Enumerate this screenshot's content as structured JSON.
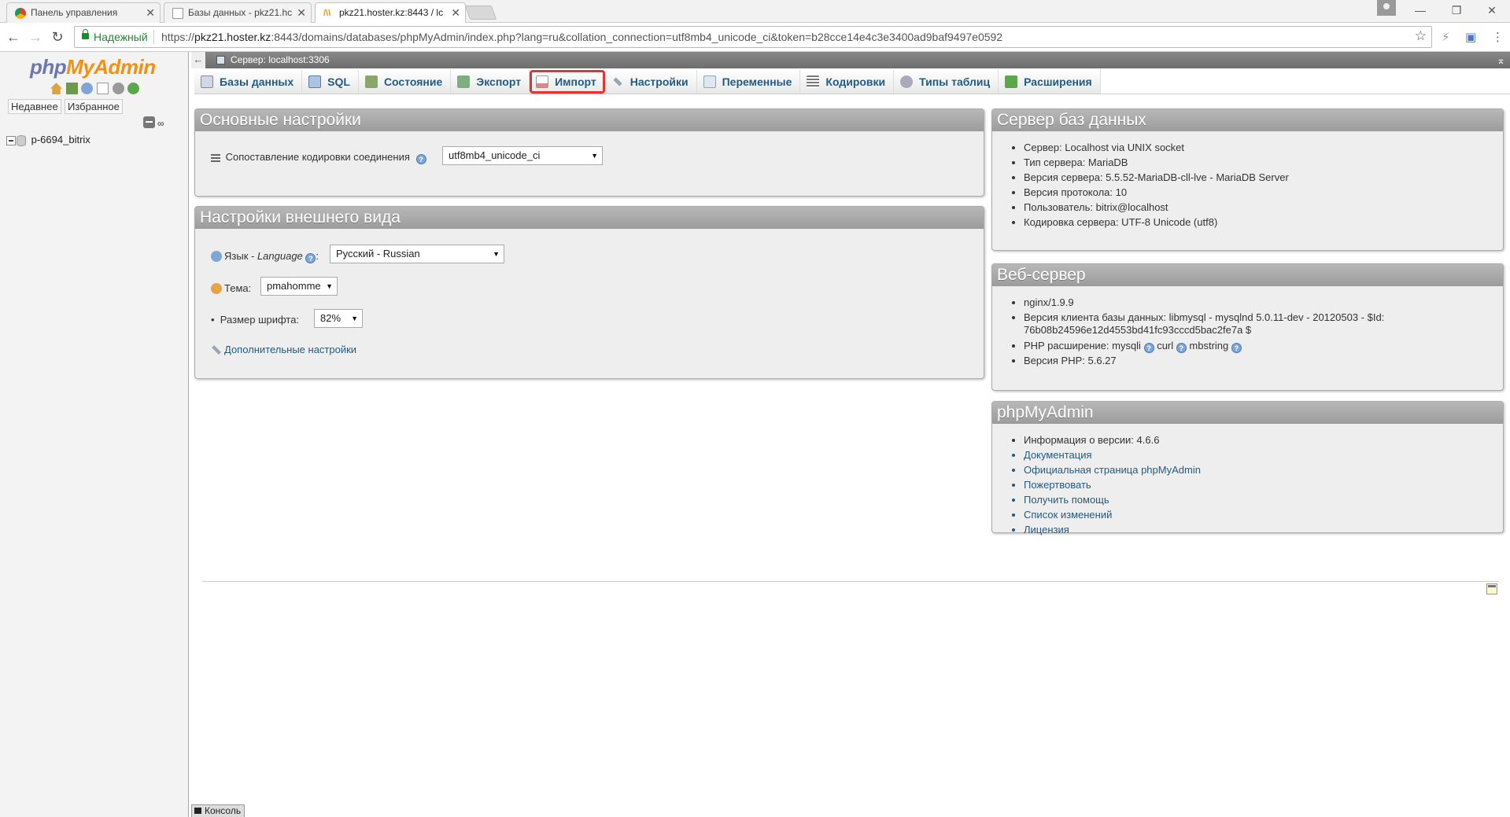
{
  "browser": {
    "tabs": [
      {
        "title": "Панель управления",
        "active": false
      },
      {
        "title": "Базы данных - pkz21.hc",
        "active": false
      },
      {
        "title": "pkz21.hoster.kz:8443 / lc",
        "active": true
      }
    ],
    "secure_label": "Надежный",
    "url_prefix": "https://",
    "url_host": "pkz21.hoster.kz",
    "url_rest": ":8443/domains/databases/phpMyAdmin/index.php?lang=ru&collation_connection=utf8mb4_unicode_ci&token=b28cce14e4c3e3400ad9baf9497e0592"
  },
  "left": {
    "logo_php": "php",
    "logo_myadmin": "MyAdmin",
    "recent": "Недавнее",
    "favorites": "Избранное",
    "database": "p-6694_bitrix"
  },
  "serverbar": {
    "label": "Сервер: localhost:3306"
  },
  "menu": [
    {
      "label": "Базы данных",
      "icon": "databases-icon",
      "color": "#cfd8e6"
    },
    {
      "label": "SQL",
      "icon": "sql-icon",
      "color": "#aac4e6"
    },
    {
      "label": "Состояние",
      "icon": "status-icon",
      "color": "#8aa66a"
    },
    {
      "label": "Экспорт",
      "icon": "export-icon",
      "color": "#7fae7f"
    },
    {
      "label": "Импорт",
      "icon": "import-icon",
      "color": "#d88"
    },
    {
      "label": "Настройки",
      "icon": "settings-icon",
      "color": "#9aa4b4"
    },
    {
      "label": "Переменные",
      "icon": "variables-icon",
      "color": "#b0c4de"
    },
    {
      "label": "Кодировки",
      "icon": "charsets-icon",
      "color": "#777"
    },
    {
      "label": "Типы таблиц",
      "icon": "engines-icon",
      "color": "#aab"
    },
    {
      "label": "Расширения",
      "icon": "plugins-icon",
      "color": "#5aa84a"
    }
  ],
  "general": {
    "title": "Основные настройки",
    "collation_label": "Сопоставление кодировки соединения",
    "collation_value": "utf8mb4_unicode_ci"
  },
  "appearance": {
    "title": "Настройки внешнего вида",
    "language_label": "Язык - ",
    "language_label_italic": "Language",
    "language_value": "Русский - Russian",
    "theme_label": "Тема:",
    "theme_value": "pmahomme",
    "fontsize_label": "Размер шрифта:",
    "fontsize_value": "82%",
    "more_settings": "Дополнительные настройки"
  },
  "dbserver": {
    "title": "Сервер баз данных",
    "items": [
      "Сервер: Localhost via UNIX socket",
      "Тип сервера: MariaDB",
      "Версия сервера: 5.5.52-MariaDB-cll-lve - MariaDB Server",
      "Версия протокола: 10",
      "Пользователь: bitrix@localhost",
      "Кодировка сервера: UTF-8 Unicode (utf8)"
    ]
  },
  "webserver": {
    "title": "Веб-сервер",
    "nginx": "nginx/1.9.9",
    "client_line1": "Версия клиента базы данных: libmysql - mysqlnd 5.0.11-dev - 20120503 - $Id:",
    "client_line2": "76b08b24596e12d4553bd41fc93cccd5bac2fe7a $",
    "php_ext_label": "PHP расширение: mysqli",
    "php_ext_curl": "curl",
    "php_ext_mbstring": "mbstring",
    "php_version": "Версия PHP: 5.6.27"
  },
  "pma": {
    "title": "phpMyAdmin",
    "version": "Информация о версии: 4.6.6",
    "links": [
      "Документация",
      "Официальная страница phpMyAdmin",
      "Пожертвовать",
      "Получить помощь",
      "Список изменений",
      "Лицензия"
    ]
  },
  "console": "Консоль"
}
